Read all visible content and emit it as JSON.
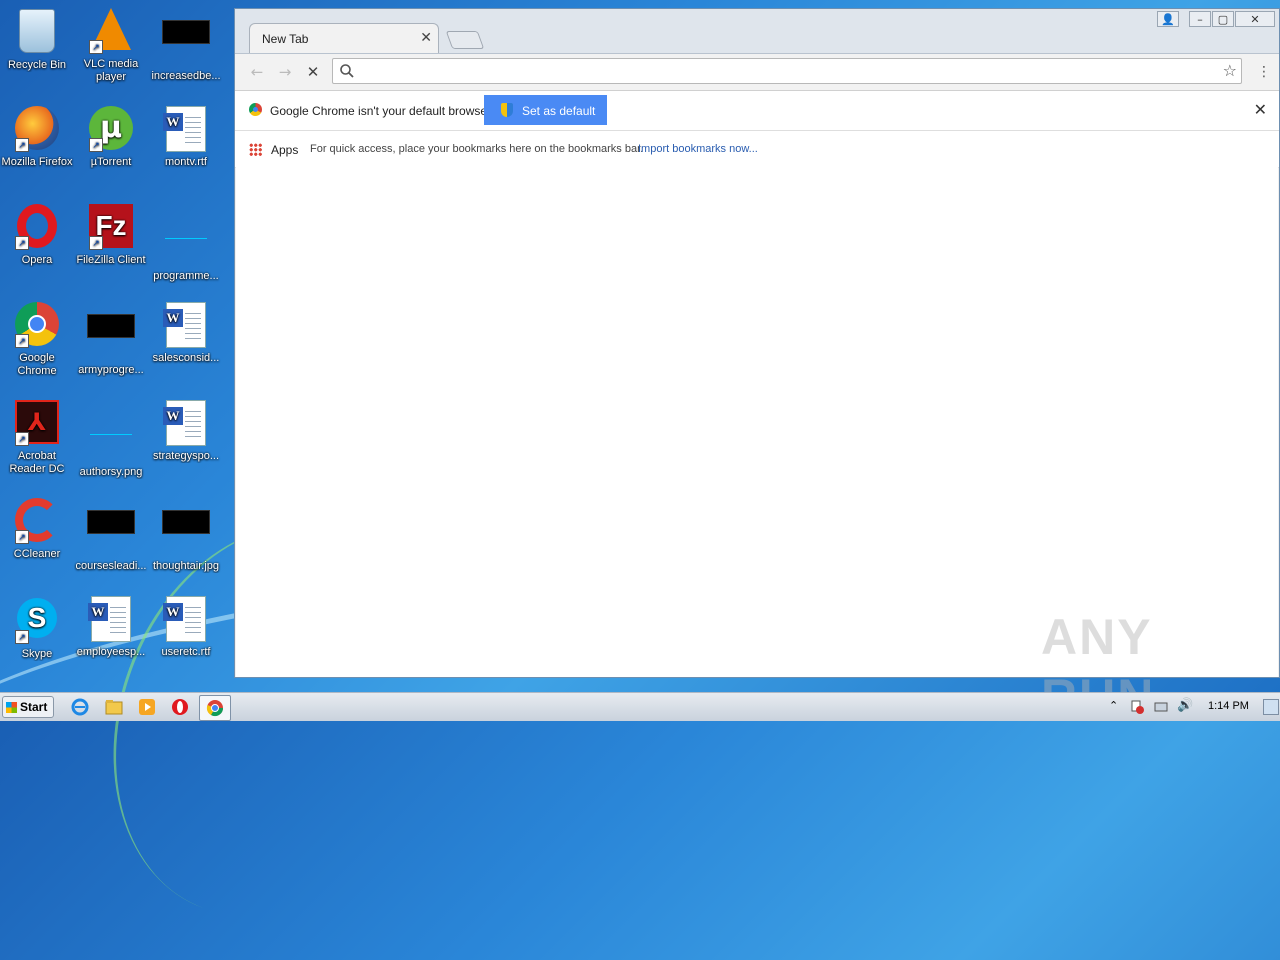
{
  "desktop": {
    "icons": [
      {
        "label": "Recycle Bin"
      },
      {
        "label": "VLC media player"
      },
      {
        "label": "increasedbe..."
      },
      {
        "label": "Mozilla Firefox"
      },
      {
        "label": "µTorrent"
      },
      {
        "label": "montv.rtf"
      },
      {
        "label": "Opera"
      },
      {
        "label": "FileZilla Client"
      },
      {
        "label": "programme..."
      },
      {
        "label": "Google Chrome"
      },
      {
        "label": "armyprogre..."
      },
      {
        "label": "salesconsid..."
      },
      {
        "label": "Acrobat Reader DC"
      },
      {
        "label": "authorsy.png"
      },
      {
        "label": "strategyspo..."
      },
      {
        "label": "CCleaner"
      },
      {
        "label": "coursesleadi..."
      },
      {
        "label": "thoughtair.jpg"
      },
      {
        "label": "Skype"
      },
      {
        "label": "employeesp..."
      },
      {
        "label": "useretc.rtf"
      }
    ]
  },
  "browser": {
    "tab_title": "New Tab",
    "omnibox_value": "",
    "infobar": {
      "message": "Google Chrome isn't your default browser.",
      "button": "Set as default"
    },
    "bookmarks": {
      "apps": "Apps",
      "hint": "For quick access, place your bookmarks here on the bookmarks bar.",
      "import_link": "Import bookmarks now..."
    }
  },
  "watermark": "ANY RUN",
  "taskbar": {
    "start": "Start",
    "clock": "1:14 PM"
  }
}
